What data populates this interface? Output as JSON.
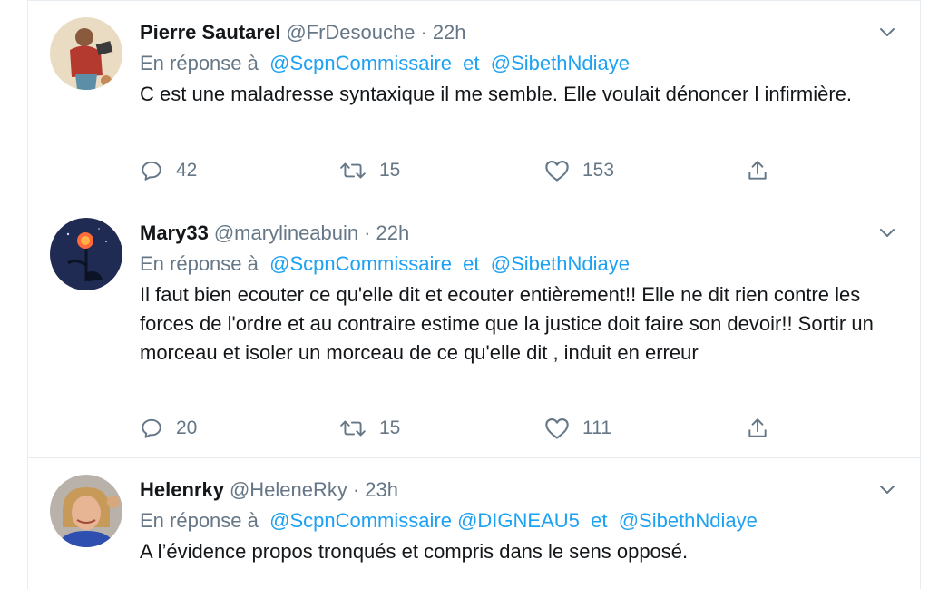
{
  "tweets": [
    {
      "name": "Pierre Sautarel",
      "handle": "@FrDesouche",
      "separator": "·",
      "time": "22h",
      "reply_prefix": "En réponse à",
      "mentions": [
        "@ScpnCommissaire",
        "et",
        "@SibethNdiaye"
      ],
      "text": "C est une maladresse syntaxique il me semble. Elle voulait dénoncer l infirmière.",
      "replies": "42",
      "retweets": "15",
      "likes": "153"
    },
    {
      "name": "Mary33",
      "handle": "@marylineabuin",
      "separator": "·",
      "time": "22h",
      "reply_prefix": "En réponse à",
      "mentions": [
        "@ScpnCommissaire",
        "et",
        "@SibethNdiaye"
      ],
      "text": "Il faut bien ecouter ce qu'elle dit et ecouter entièrement!!  Elle ne dit rien contre les forces de l'ordre et au contraire estime que la justice doit faire son devoir!! Sortir un morceau et isoler un morceau de ce qu'elle dit , induit en erreur",
      "replies": "20",
      "retweets": "15",
      "likes": "111"
    },
    {
      "name": "Helenrky",
      "handle": "@HeleneRky",
      "separator": "·",
      "time": "23h",
      "reply_prefix": "En réponse à",
      "mentions": [
        "@ScpnCommissaire",
        "@DIGNEAU5",
        "et",
        "@SibethNdiaye"
      ],
      "text": "A l’évidence propos tronqués et compris dans le sens opposé."
    }
  ],
  "colors": {
    "link": "#1da1f2",
    "secondary_text": "#657786",
    "primary_text": "#14171a",
    "border": "#e6ecf0"
  },
  "icons": [
    "chevron-down-icon",
    "reply-icon",
    "retweet-icon",
    "like-icon",
    "share-icon"
  ]
}
